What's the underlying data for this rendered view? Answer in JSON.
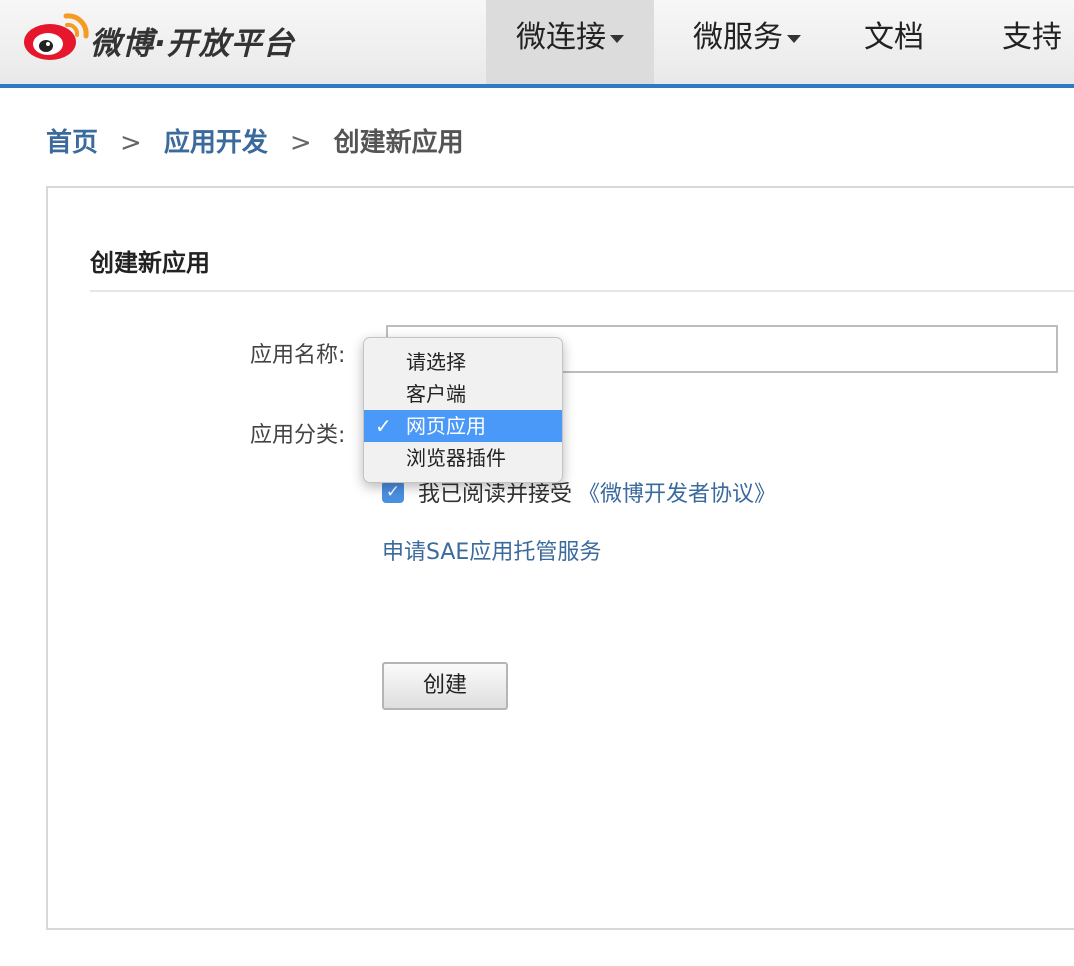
{
  "header": {
    "logo_text": "微博·开放平台",
    "nav": [
      {
        "label": "微连接",
        "has_caret": true,
        "active": true
      },
      {
        "label": "微服务",
        "has_caret": true,
        "active": false
      },
      {
        "label": "文档",
        "has_caret": false,
        "active": false
      },
      {
        "label": "支持",
        "has_caret": false,
        "active": false
      }
    ]
  },
  "breadcrumb": {
    "home": "首页",
    "sep1": ">",
    "section": "应用开发",
    "sep2": ">",
    "current": "创建新应用"
  },
  "form": {
    "title": "创建新应用",
    "name_label": "应用名称:",
    "name_value": "",
    "category_label": "应用分类:",
    "category_options": [
      "请选择",
      "客户端",
      "网页应用",
      "浏览器插件"
    ],
    "category_selected": "网页应用",
    "agree_checked": true,
    "agree_text": "我已阅读并接受",
    "agree_link": "《微博开发者协议》",
    "sae_link": "申请SAE应用托管服务",
    "submit_label": "创建"
  },
  "colors": {
    "accent_blue": "#2e7ac4",
    "link_blue": "#3b6a9c",
    "dropdown_highlight": "#4a98f7",
    "logo_red": "#e6162d",
    "logo_orange": "#f59a23"
  },
  "icons": {
    "logo": "weibo-eye-logo",
    "caret": "caret-down-icon",
    "check": "checkmark-icon"
  }
}
